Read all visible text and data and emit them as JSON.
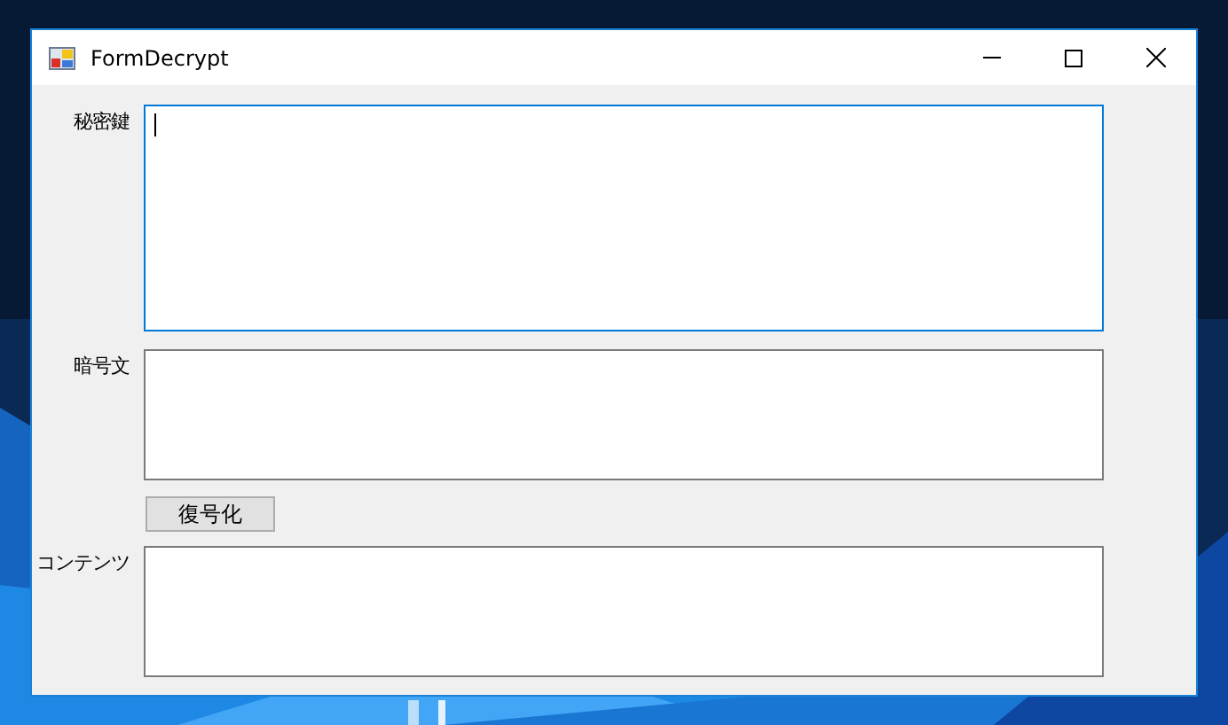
{
  "window": {
    "title": "FormDecrypt"
  },
  "rows": [
    {
      "kind": "memo",
      "label": "秘密鍵",
      "focused": true
    },
    {
      "kind": "field",
      "label": "暗号文",
      "focused": false
    },
    {
      "kind": "button",
      "label": "復号化"
    },
    {
      "kind": "field",
      "label": "コンテンツ",
      "focused": false
    }
  ]
}
